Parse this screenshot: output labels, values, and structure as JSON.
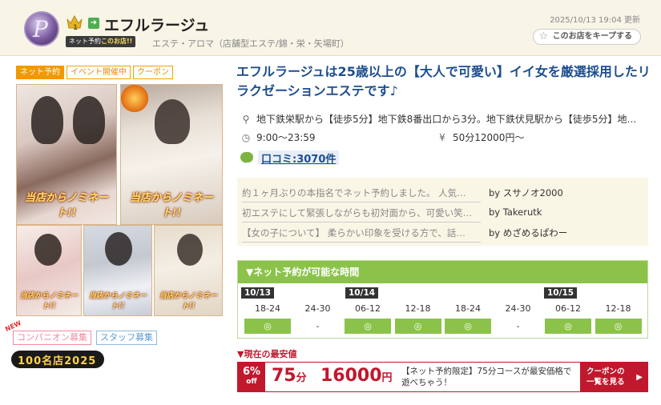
{
  "header": {
    "logo_letter": "P",
    "rank": "1",
    "shop_name": "エフルラージュ",
    "net_badge_prefix": "ネット予約",
    "net_badge_suffix": "このお店!!",
    "category": "エステ・アロマ（店舗型エステ/錦・栄・矢場町）",
    "updated": "2025/10/13 19:04 更新",
    "keep_label": "このお店をキープする"
  },
  "tags": [
    "ネット予約",
    "イベント開催中",
    "クーポン"
  ],
  "photos": {
    "caption_main": "当店からノミネート!!",
    "caption_small": "当店からノミネート!!"
  },
  "recruit": {
    "new_label": "NEW",
    "companion": "コンパニオン募集",
    "staff": "スタッフ募集"
  },
  "award": "100名店2025",
  "catchcopy": "エフルラージュは25歳以上の【大人で可愛い】イイ女を厳選採用したリラクゼーションエステです♪",
  "info": {
    "access": "地下鉄栄駅から【徒歩5分】地下鉄8番出口から3分。地下鉄伏見駅から【徒歩5分】地…",
    "hours": "9:00〜23:59",
    "price": "50分12000円〜"
  },
  "kuchikomi": "口コミ:3070件",
  "reviews": [
    {
      "text": "約１ヶ月ぶりの本指名でネット予約しました。 人気…",
      "by": "by スサノオ2000"
    },
    {
      "text": "初エステにして緊張しながらも初対面から、可愛い笑…",
      "by": "by Takerutk"
    },
    {
      "text": "【女の子について】 柔らかい印象を受ける方で、話…",
      "by": "by めざめるぱわー"
    }
  ],
  "reserve": {
    "title": "▼ネット予約が可能な時間",
    "dates": [
      "10/13",
      "10/14",
      "10/15"
    ],
    "slots": [
      {
        "time": "18-24",
        "mark": "◎",
        "ok": true
      },
      {
        "time": "24-30",
        "mark": "-",
        "ok": false
      },
      {
        "time": "06-12",
        "mark": "◎",
        "ok": true
      },
      {
        "time": "12-18",
        "mark": "◎",
        "ok": true
      },
      {
        "time": "18-24",
        "mark": "◎",
        "ok": true
      },
      {
        "time": "24-30",
        "mark": "-",
        "ok": false
      },
      {
        "time": "06-12",
        "mark": "◎",
        "ok": true
      },
      {
        "time": "12-18",
        "mark": "◎",
        "ok": true
      }
    ]
  },
  "deal": {
    "label": "▼現在の最安値",
    "off_pct": "6%",
    "off_word": "off",
    "minutes": "75",
    "minutes_unit": "分",
    "price": "16000",
    "price_unit": "円",
    "note": "【ネット予約限定】75分コースが最安価格で遊べちゃう！",
    "coupon_line1": "クーポンの",
    "coupon_line2": "一覧を見る"
  },
  "colors": {
    "accent_blue": "#1d4e8f",
    "reserve_green": "#8bc34a",
    "deal_red": "#c0182c",
    "tag_orange": "#f39800"
  }
}
